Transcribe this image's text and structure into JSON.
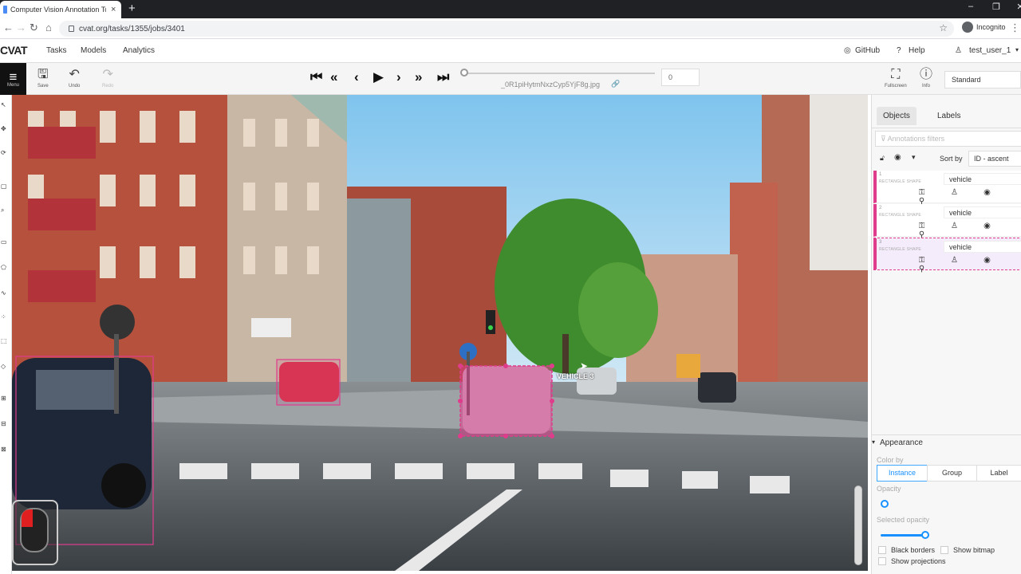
{
  "browser": {
    "tab_title": "Computer Vision Annotation Toc",
    "tab_close": "×",
    "new_tab": "+",
    "url": "cvat.org/tasks/1355/jobs/3401",
    "incognito_label": "Incognito",
    "window_controls": [
      "–",
      "❐",
      "✕"
    ]
  },
  "header": {
    "logo": "CVAT",
    "nav": [
      "Tasks",
      "Models",
      "Analytics"
    ],
    "github": "GitHub",
    "help": "Help",
    "user": "test_user_1"
  },
  "toolbar": {
    "menu_label": "Menu",
    "save_label": "Save",
    "undo_label": "Undo",
    "redo_label": "Redo",
    "filename": "_0R1piHytmNxzCyp5YjF8g.jpg",
    "frame_number": "0",
    "fullscreen_label": "Fullscreen",
    "info_label": "Info",
    "workspace": "Standard"
  },
  "canvas": {
    "selected_label": "VEHICLE 3"
  },
  "sidebar": {
    "tabs": [
      "Objects",
      "Labels"
    ],
    "filter_placeholder": "Annotations filters",
    "sort_by_label": "Sort by",
    "sort_value": "ID - ascent",
    "objects": [
      {
        "id": "1",
        "type": "RECTANGLE SHAPE",
        "label": "vehicle"
      },
      {
        "id": "2",
        "type": "RECTANGLE SHAPE",
        "label": "vehicle"
      },
      {
        "id": "3",
        "type": "RECTANGLE SHAPE",
        "label": "vehicle"
      }
    ],
    "appearance": {
      "title": "Appearance",
      "color_by_label": "Color by",
      "color_by_options": [
        "Instance",
        "Group",
        "Label"
      ],
      "opacity_label": "Opacity",
      "selected_opacity_label": "Selected opacity",
      "black_borders_label": "Black borders",
      "show_bitmap_label": "Show bitmap",
      "show_projections_label": "Show projections"
    }
  },
  "colors": {
    "annotation": "#e03c8c",
    "accent": "#1890ff"
  }
}
